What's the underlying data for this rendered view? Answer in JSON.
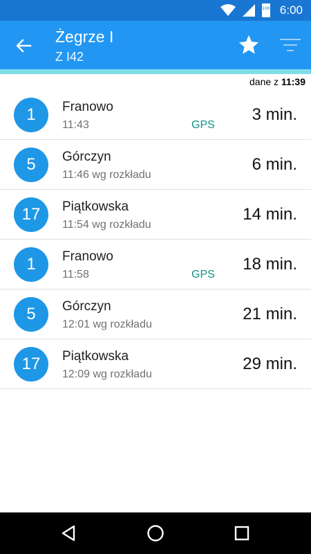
{
  "status_bar": {
    "time": "6:00",
    "battery_level": "100"
  },
  "header": {
    "title": "Żegrze I",
    "subtitle": "Z I42",
    "primary_color": "#2196f3",
    "accent_strip_color": "#80deea"
  },
  "updated": {
    "prefix": "dane z",
    "time": "11:39"
  },
  "departures": [
    {
      "line": "1",
      "destination": "Franowo",
      "time": "11:43",
      "gps": "GPS",
      "eta": "3 min."
    },
    {
      "line": "5",
      "destination": "Górczyn",
      "time": "11:46 wg rozkładu",
      "gps": "",
      "eta": "6 min."
    },
    {
      "line": "17",
      "destination": "Piątkowska",
      "time": "11:54 wg rozkładu",
      "gps": "",
      "eta": "14 min."
    },
    {
      "line": "1",
      "destination": "Franowo",
      "time": "11:58",
      "gps": "GPS",
      "eta": "18 min."
    },
    {
      "line": "5",
      "destination": "Górczyn",
      "time": "12:01 wg rozkładu",
      "gps": "",
      "eta": "21 min."
    },
    {
      "line": "17",
      "destination": "Piątkowska",
      "time": "12:09 wg rozkładu",
      "gps": "",
      "eta": "29 min."
    }
  ],
  "icons": {
    "back": "arrow-back-icon",
    "favorite": "star-icon",
    "filter": "filter-icon",
    "nav_back": "nav-back-icon",
    "nav_home": "nav-home-icon",
    "nav_recents": "nav-recents-icon"
  },
  "colors": {
    "badge": "#1e97e6",
    "gps": "#119185"
  }
}
